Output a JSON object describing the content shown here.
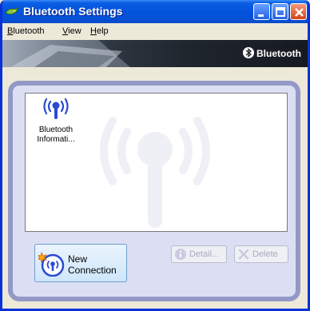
{
  "window": {
    "title": "Bluetooth Settings"
  },
  "menu": {
    "items": [
      {
        "label": "Bluetooth",
        "underline": "B",
        "rest": "luetooth"
      },
      {
        "label": "View",
        "underline": "V",
        "rest": "iew"
      },
      {
        "label": "Help",
        "underline": "H",
        "rest": "elp"
      }
    ]
  },
  "banner": {
    "brand": "Bluetooth",
    "brand_mark": "®"
  },
  "devices": [
    {
      "line1": "Bluetooth",
      "line2": "Informati..."
    }
  ],
  "buttons": {
    "new_connection_line1": "New",
    "new_connection_line2": "Connection",
    "detail": "Detail...",
    "delete": "Delete"
  },
  "colors": {
    "titlebar": "#0453dd",
    "window_border": "#0831d9",
    "panel_bg": "#dcdff3",
    "panel_border": "#9498c7",
    "icon_blue": "#2a4bd1",
    "new_conn_bg": "#cfe6fb"
  },
  "icons": {
    "app": "bluetooth-app-icon",
    "device": "bluetooth-antenna-icon",
    "watermark": "bluetooth-antenna-watermark",
    "new_connection": "new-connection-icon",
    "detail": "info-icon",
    "delete": "delete-x-icon",
    "brand": "bluetooth-logo-icon"
  }
}
